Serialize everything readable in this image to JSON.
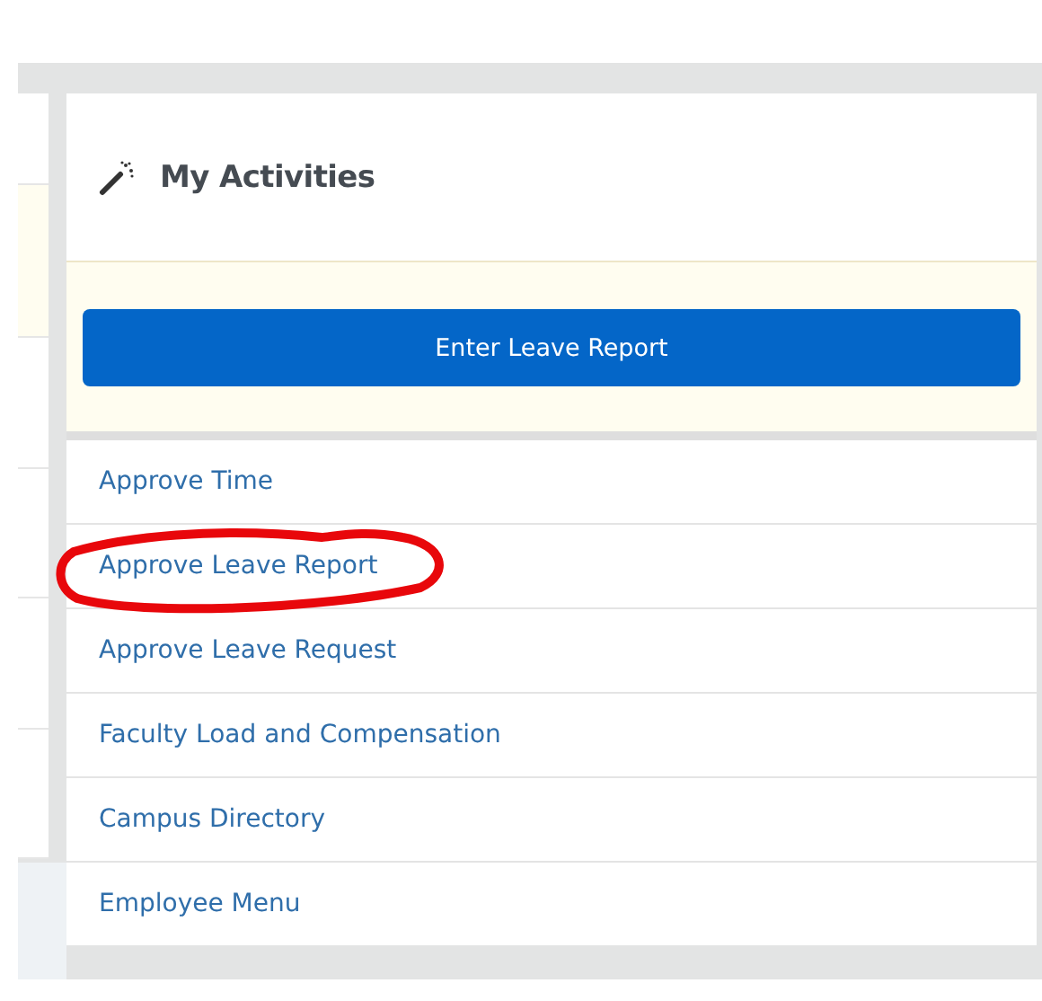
{
  "card": {
    "title": "My Activities",
    "primary_button": "Enter Leave Report",
    "links": [
      {
        "label": "Approve Time",
        "highlighted": false
      },
      {
        "label": "Approve Leave Report",
        "highlighted": true
      },
      {
        "label": "Approve Leave Request",
        "highlighted": false
      },
      {
        "label": "Faculty Load and Compensation",
        "highlighted": false
      },
      {
        "label": "Campus Directory",
        "highlighted": false
      },
      {
        "label": "Employee Menu",
        "highlighted": false
      }
    ]
  }
}
